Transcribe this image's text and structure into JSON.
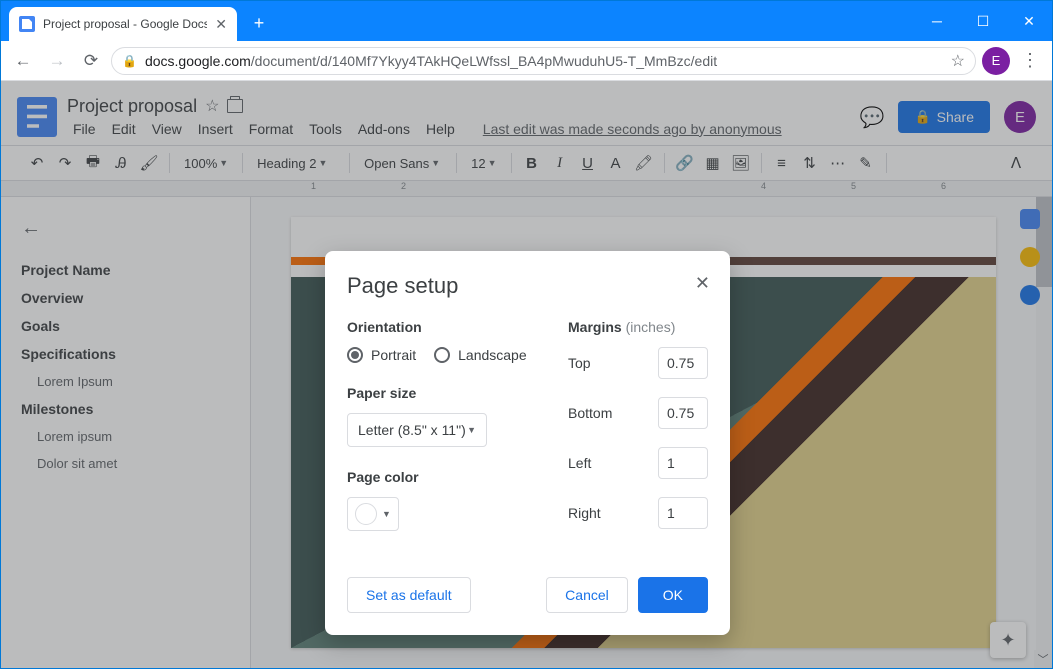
{
  "browser": {
    "tab_title": "Project proposal - Google Docs",
    "url_host": "docs.google.com",
    "url_path": "/document/d/140Mf7Ykyy4TAkHQeLWfssl_BA4pMwuduhU5-T_MmBzc/edit",
    "avatar_letter": "E"
  },
  "doc": {
    "title": "Project proposal",
    "menus": [
      "File",
      "Edit",
      "View",
      "Insert",
      "Format",
      "Tools",
      "Add-ons",
      "Help"
    ],
    "last_edit": "Last edit was made seconds ago by anonymous",
    "share_label": "Share",
    "avatar_letter": "E"
  },
  "toolbar": {
    "zoom": "100%",
    "style": "Heading 2",
    "font": "Open Sans",
    "size": "12"
  },
  "ruler": {
    "marks": [
      "1",
      "2",
      "",
      "4",
      "5",
      "6"
    ]
  },
  "outline": {
    "items": [
      {
        "label": "Project Name",
        "level": 0
      },
      {
        "label": "Overview",
        "level": 0
      },
      {
        "label": "Goals",
        "level": 0
      },
      {
        "label": "Specifications",
        "level": 0
      },
      {
        "label": "Lorem Ipsum",
        "level": 1
      },
      {
        "label": "Milestones",
        "level": 0
      },
      {
        "label": "Lorem ipsum",
        "level": 1
      },
      {
        "label": "Dolor sit amet",
        "level": 1
      }
    ]
  },
  "dialog": {
    "title": "Page setup",
    "orientation_label": "Orientation",
    "portrait": "Portrait",
    "landscape": "Landscape",
    "paper_size_label": "Paper size",
    "paper_size_value": "Letter (8.5\" x 11\")",
    "page_color_label": "Page color",
    "margins_label": "Margins",
    "margins_hint": "(inches)",
    "margins": {
      "top": {
        "label": "Top",
        "value": "0.75"
      },
      "bottom": {
        "label": "Bottom",
        "value": "0.75"
      },
      "left": {
        "label": "Left",
        "value": "1"
      },
      "right": {
        "label": "Right",
        "value": "1"
      }
    },
    "set_default": "Set as default",
    "cancel": "Cancel",
    "ok": "OK"
  }
}
